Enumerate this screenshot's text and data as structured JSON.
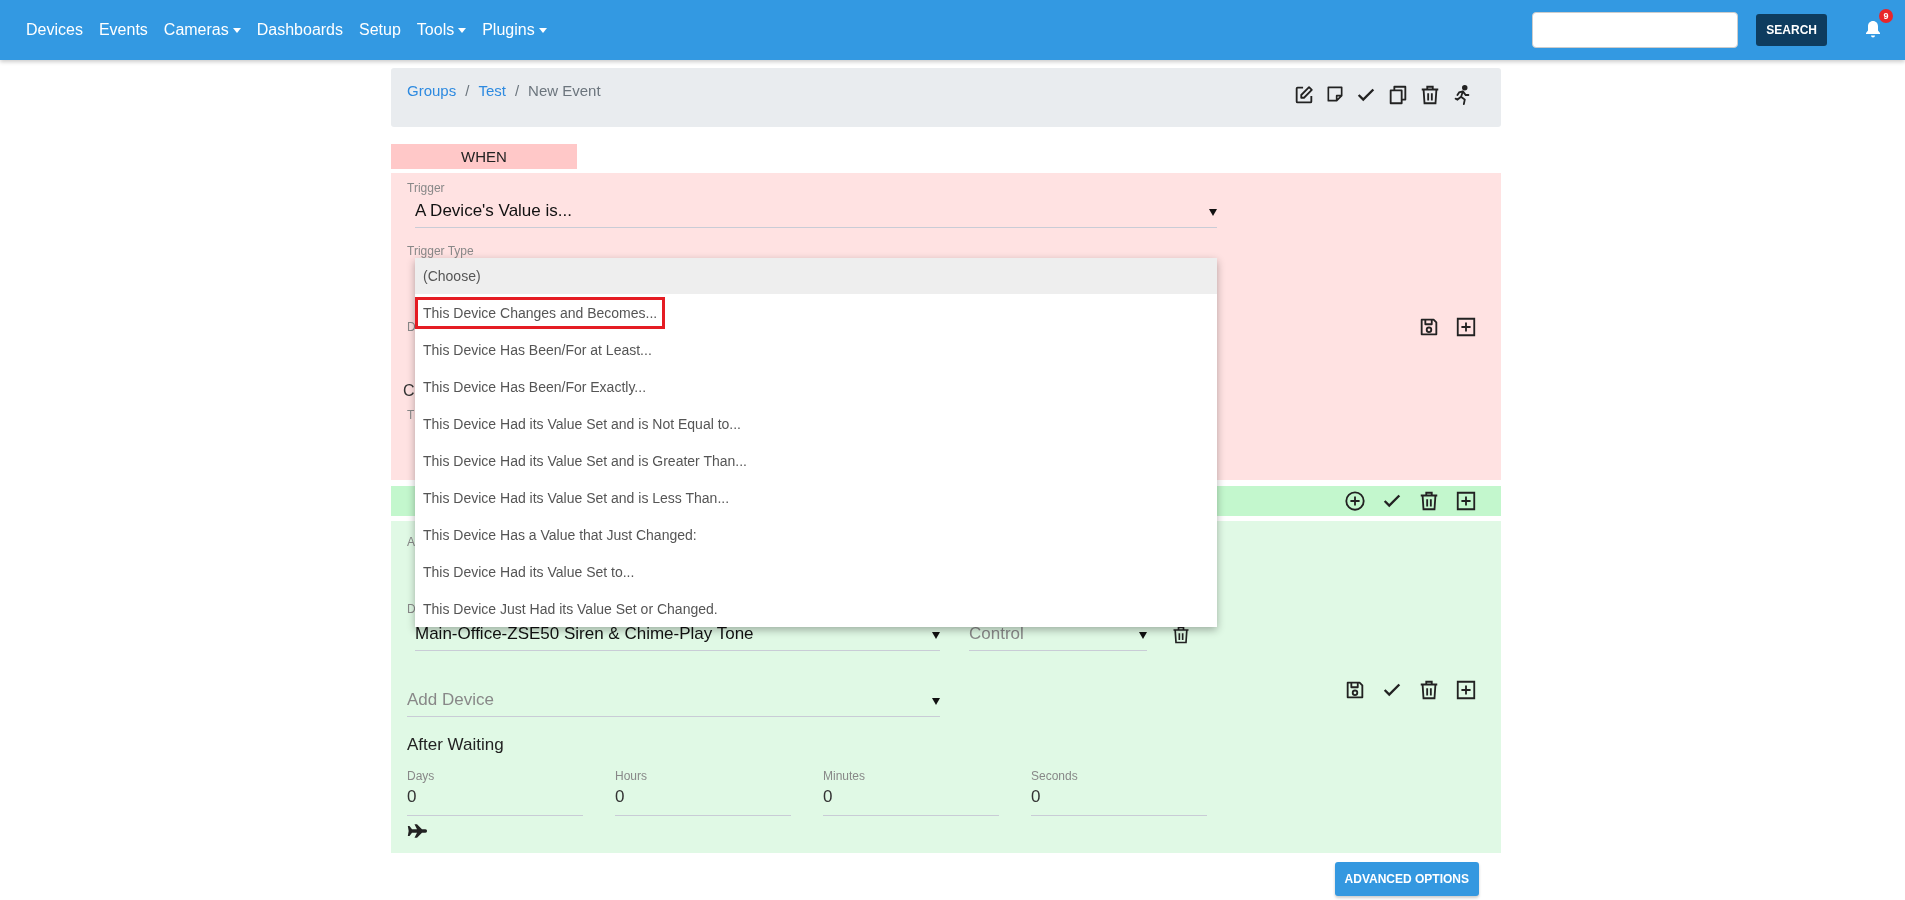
{
  "nav": {
    "items": [
      {
        "label": "Devices",
        "dropdown": false
      },
      {
        "label": "Events",
        "dropdown": false
      },
      {
        "label": "Cameras",
        "dropdown": true
      },
      {
        "label": "Dashboards",
        "dropdown": false
      },
      {
        "label": "Setup",
        "dropdown": false
      },
      {
        "label": "Tools",
        "dropdown": true
      },
      {
        "label": "Plugins",
        "dropdown": true
      }
    ],
    "search_button": "SEARCH",
    "notification_badge": "9"
  },
  "breadcrumb": [
    {
      "label": "Groups",
      "kind": "link"
    },
    {
      "label": "/",
      "kind": "separator"
    },
    {
      "label": "Test",
      "kind": "link"
    },
    {
      "label": "/",
      "kind": "separator"
    },
    {
      "label": "New Event",
      "kind": "current"
    }
  ],
  "when_tag": "WHEN",
  "trigger": {
    "label": "Trigger",
    "value": "A Device's Value is..."
  },
  "trigger_type": {
    "label": "Trigger Type"
  },
  "when_covered_labels": [
    {
      "text": "D",
      "kind": "label"
    },
    {
      "text": "C",
      "kind": "heading"
    },
    {
      "text": "T",
      "kind": "label"
    }
  ],
  "dropdown": {
    "options": [
      {
        "label": "(Choose)",
        "selected": true,
        "highlighted": false
      },
      {
        "label": "This Device Changes and Becomes...",
        "selected": false,
        "highlighted": true
      },
      {
        "label": "This Device Has Been/For at Least...",
        "selected": false,
        "highlighted": false
      },
      {
        "label": "This Device Has Been/For Exactly...",
        "selected": false,
        "highlighted": false
      },
      {
        "label": "This Device Had its Value Set and is Not Equal to...",
        "selected": false,
        "highlighted": false
      },
      {
        "label": "This Device Had its Value Set and is Greater Than...",
        "selected": false,
        "highlighted": false
      },
      {
        "label": "This Device Had its Value Set and is Less Than...",
        "selected": false,
        "highlighted": false
      },
      {
        "label": "This Device Has a Value that Just Changed:",
        "selected": false,
        "highlighted": false
      },
      {
        "label": "This Device Had its Value Set to...",
        "selected": false,
        "highlighted": false
      },
      {
        "label": "This Device Just Had its Value Set or Changed.",
        "selected": false,
        "highlighted": false
      }
    ]
  },
  "actions": {
    "covered_labels": [
      {
        "text": "A"
      },
      {
        "text": "D"
      }
    ],
    "device": {
      "value": "Main-Office-ZSE50 Siren & Chime-Play Tone"
    },
    "control": {
      "placeholder": "Control"
    },
    "add_device": {
      "placeholder": "Add Device"
    },
    "after_waiting": {
      "title": "After Waiting",
      "fields": [
        {
          "label": "Days",
          "value": "0"
        },
        {
          "label": "Hours",
          "value": "0"
        },
        {
          "label": "Minutes",
          "value": "0"
        },
        {
          "label": "Seconds",
          "value": "0"
        }
      ]
    }
  },
  "advanced_button": "ADVANCED OPTIONS"
}
